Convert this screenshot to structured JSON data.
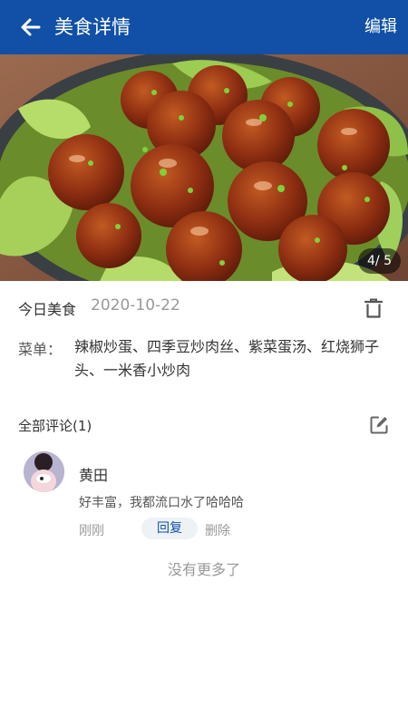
{
  "header": {
    "title": "美食详情",
    "edit_label": "编辑",
    "color": "#1150a6"
  },
  "gallery": {
    "page_indicator": "4/ 5"
  },
  "detail": {
    "label": "今日美食",
    "date": "2020-10-22",
    "menu_label": "菜单：",
    "menu_items": "辣椒炒蛋、四季豆炒肉丝、紫菜蛋汤、红烧狮子头、一米香小炒肉"
  },
  "comments": {
    "title": "全部评论(1)",
    "items": [
      {
        "user": "黄田",
        "text": "好丰富，我都流口水了哈哈哈",
        "time": "刚刚",
        "reply_label": "回复",
        "delete_label": "删除"
      }
    ],
    "no_more": "没有更多了"
  },
  "icons": {
    "back": "arrow-left-icon",
    "trash": "trash-icon",
    "write": "edit-icon"
  }
}
